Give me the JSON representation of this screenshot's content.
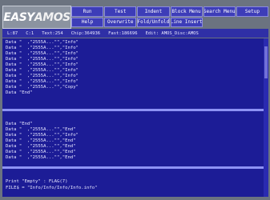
{
  "header": {
    "logo_left": "EASY",
    "logo_right": "AMOS"
  },
  "toolbar": [
    "Run",
    "Test",
    "Indent",
    "Block Menu",
    "Search Menu",
    "Setup",
    "Help",
    "Overwrite",
    "Fold/Unfold",
    "Line Insert"
  ],
  "status": {
    "line": "L:87",
    "col": "C:1",
    "text": "Text:254",
    "chip": "Chip:364936",
    "fast": "Fast:186696",
    "edit": "Edit: AMOS_Disc:AMOS"
  },
  "code_lines": [
    "Data \"  ,\"2555A...\"\",\"Info\"",
    "Data \"  ,\"2555A...\"\",\"Info\"",
    "Data \"  ,\"2555A...\"\",\"Info\"",
    "Data \"  ,\"2555A...\"\",\"Info\"",
    "Data \"  ,\"2555A...\"\",\"Info\"",
    "Data \"  ,\"2555A...\"\",\"Info\"",
    "Data \"  ,\"2555A...\"\",\"Info\"",
    "Data \"  ,\"2555A...\"\",\"Info\"",
    "Data \"  ,\"2555A...\"\",\"Copy\"",
    "Data \"End\"",
    "",
    "",
    "Data \"End\"",
    "Data \"  ,\"2555A...\"\",\"End\"",
    "Data \"  ,\"2555A...\"\",\"Info\"",
    "Data \"  ,\"2555A...\"\",\"End\"",
    "Data \"  ,\"2555A...\"\",\"End\"",
    "Data \"  ,\"2555A...\"\",\"End\"",
    "Data \"  ,\"2555A...\"\",\"End\"",
    "",
    "",
    "Print \"Empty\" : FLAG(7)",
    "FILE$ = \"Info/Info/Info/Info.info\""
  ]
}
